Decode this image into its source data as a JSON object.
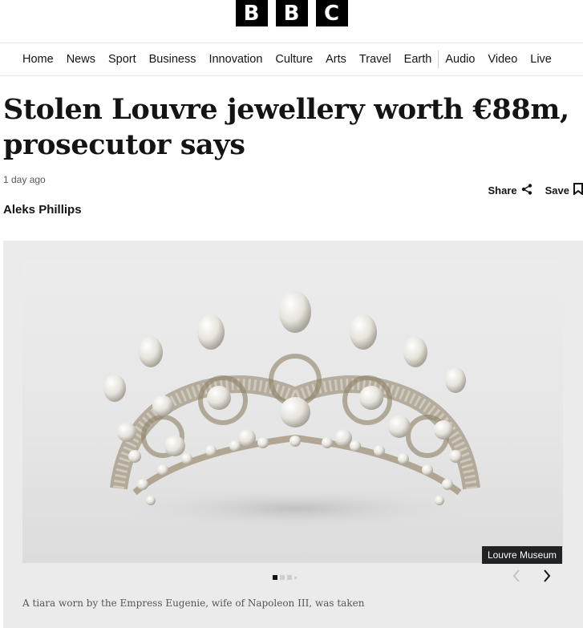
{
  "logo": {
    "letters": [
      "B",
      "B",
      "C"
    ]
  },
  "nav": {
    "items": [
      "Home",
      "News",
      "Sport",
      "Business",
      "Innovation",
      "Culture",
      "Arts",
      "Travel",
      "Earth",
      "Audio",
      "Video",
      "Live"
    ]
  },
  "article": {
    "headline": "Stolen Louvre jewellery worth €88m, prosecutor says",
    "timestamp": "1 day ago",
    "share_label": "Share",
    "save_label": "Save",
    "author": "Aleks Phillips"
  },
  "gallery": {
    "credit": "Louvre Museum",
    "caption": "A tiara worn by the Empress Eugenie, wife of Napoleon III, was taken",
    "slide_count": 4,
    "active_slide": 1
  }
}
